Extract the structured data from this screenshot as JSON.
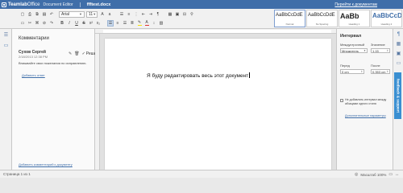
{
  "titlebar": {
    "logo_team": "Teamlab",
    "logo_office": "Office",
    "app_name": "Document Editor",
    "doc_title": "ffftest.docx",
    "goto_docs": "Перейти к документам"
  },
  "toolbar": {
    "font_name": "Arial",
    "font_size": "11",
    "bold": "B",
    "italic": "I",
    "underline": "U",
    "strike": "S",
    "pilcrow": "¶",
    "highlight_color": "#f5e100",
    "font_color": "#e03030",
    "styles": [
      {
        "sample": "AaBbCcDdE",
        "name": "Normal"
      },
      {
        "sample": "AaBbCcDdE",
        "name": "No Spacing"
      },
      {
        "sample": "AaBb",
        "name": "Heading 1"
      },
      {
        "sample": "AaBbCcD",
        "name": "Heading 2"
      }
    ]
  },
  "comments": {
    "title": "Комментарии",
    "author": "Сухов Сергей",
    "date": "2/18/2013 12:38 PM",
    "resolve_label": "Решить",
    "text": "Впишвайте свои пожелания по исправлению.",
    "reply": "Добавить ответ",
    "add_comment": "Добавить комментарий к документу"
  },
  "document": {
    "line": "Я буду редактировать весь этот документ"
  },
  "paragraph_panel": {
    "title": "Интервал",
    "line_spacing_label": "Междустрочный",
    "value_label": "Значение",
    "line_spacing_value": "Множитель",
    "line_value": "1.15",
    "before_label": "Перед",
    "after_label": "После",
    "before_value": "0 cm",
    "after_value": "0.353 cm",
    "checkbox_label": "Не добавлять интервал между абзацами одного стиля",
    "advanced_link": "Дополнительные параметры"
  },
  "feedback": {
    "label": "feedback & support"
  },
  "statusbar": {
    "page_info": "Страница 1 из 1",
    "zoom": "Масштаб 100%"
  },
  "icons": {
    "menu": "☰",
    "comment": "💬",
    "search": "⌕",
    "paragraph": "¶",
    "table": "▦",
    "image": "▣",
    "header": "▭",
    "shape": "◇",
    "edit": "✎",
    "check": "✓"
  }
}
